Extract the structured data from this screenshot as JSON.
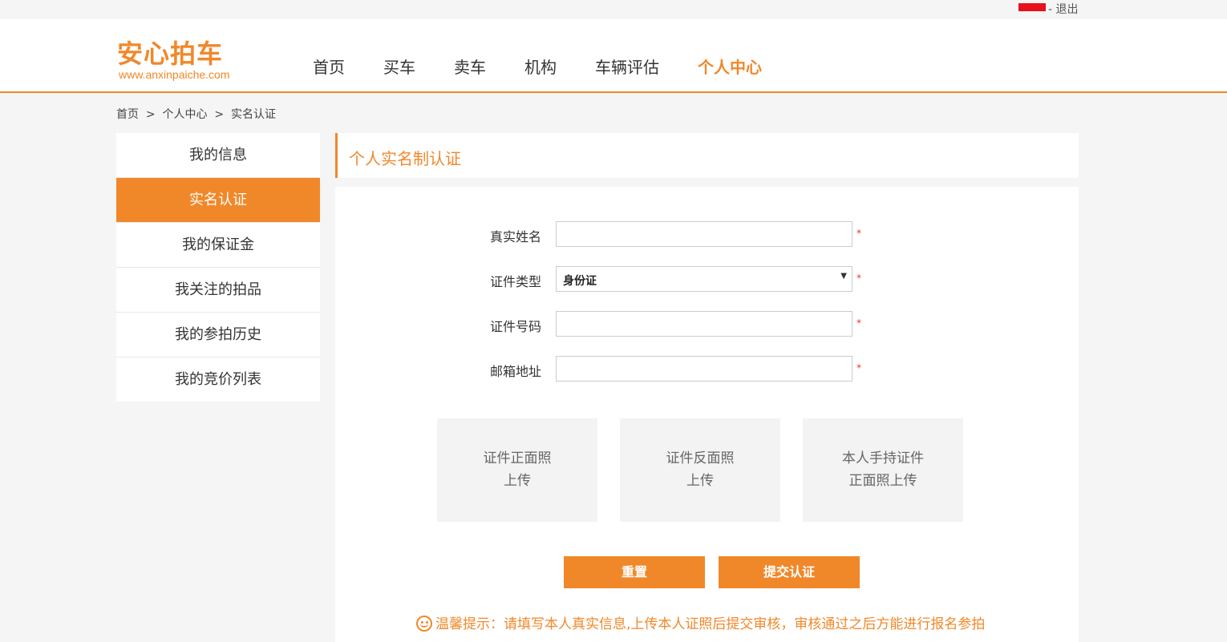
{
  "topbar": {
    "logout_text": "- 退出"
  },
  "logo": {
    "name": "安心拍车",
    "url": "www.anxinpaiche.com"
  },
  "nav": {
    "items": [
      {
        "label": "首页"
      },
      {
        "label": "买车"
      },
      {
        "label": "卖车"
      },
      {
        "label": "机构"
      },
      {
        "label": "车辆评估"
      },
      {
        "label": "个人中心",
        "active": true
      }
    ]
  },
  "breadcrumb": {
    "text": "首页  >  个人中心  >  实名认证"
  },
  "sidebar": {
    "items": [
      {
        "label": "我的信息"
      },
      {
        "label": "实名认证",
        "active": true
      },
      {
        "label": "我的保证金"
      },
      {
        "label": "我关注的拍品"
      },
      {
        "label": "我的参拍历史"
      },
      {
        "label": "我的竞价列表"
      }
    ]
  },
  "panel": {
    "title": "个人实名制认证"
  },
  "form": {
    "name_label": "真实姓名",
    "name_value": "",
    "id_type_label": "证件类型",
    "id_type_value": "身份证",
    "id_number_label": "证件号码",
    "id_number_value": "",
    "email_label": "邮箱地址",
    "email_value": "",
    "required_mark": "*"
  },
  "uploads": [
    {
      "label": "证件正面照\n上传"
    },
    {
      "label": "证件反面照\n上传"
    },
    {
      "label": "本人手持证件\n正面照上传"
    }
  ],
  "buttons": {
    "reset": "重置",
    "submit": "提交认证"
  },
  "tip": {
    "text": "温馨提示：请填写本人真实信息,上传本人证照后提交审核，审核通过之后方能进行报名参拍"
  },
  "colors": {
    "accent": "#f0882a",
    "background": "#f5f5f5",
    "required": "#e33333"
  }
}
